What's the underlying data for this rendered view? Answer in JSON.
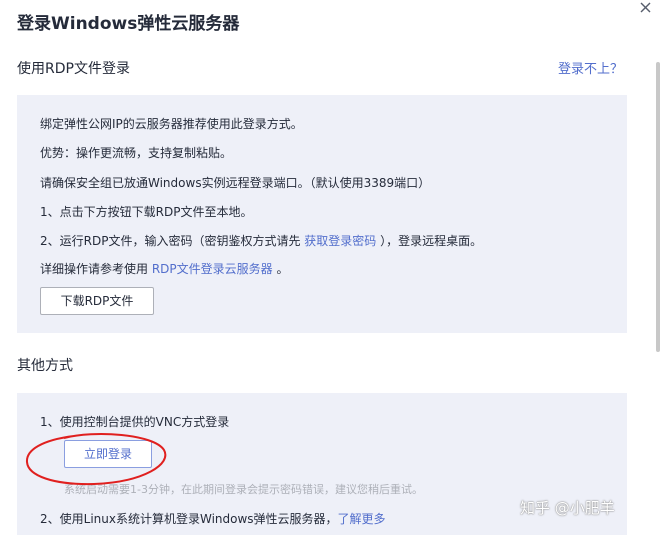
{
  "dialog": {
    "title": "登录Windows弹性云服务器"
  },
  "rdp_section": {
    "title": "使用RDP文件登录",
    "login_fail_link": "登录不上？",
    "line1": "绑定弹性公网IP的云服务器推荐使用此登录方式。",
    "line2": "优势：操作更流畅，支持复制粘贴。",
    "line3": "请确保安全组已放通Windows实例远程登录端口。（默认使用3389端口）",
    "line4": "1、点击下方按钮下载RDP文件至本地。",
    "line5_before": "2、运行RDP文件，输入密码（密钥鉴权方式请先 ",
    "line5_link": "获取登录密码",
    "line5_after": " ），登录远程桌面。",
    "line6_before": "详细操作请参考使用 ",
    "line6_link": "RDP文件登录云服务器",
    "line6_after": " 。",
    "download_button": "下载RDP文件"
  },
  "other_section": {
    "title": "其他方式",
    "vnc_line": "1、使用控制台提供的VNC方式登录",
    "login_now_button": "立即登录",
    "hint": "系统启动需要1-3分钟，在此期间登录会提示密码错误，建议您稍后重试。",
    "linux_line_before": "2、使用Linux系统计算机登录Windows弹性云服务器，",
    "linux_line_link": "了解更多"
  },
  "watermark": "知乎 @小肥羊",
  "icons": {
    "close": "close-icon"
  },
  "colors": {
    "link": "#526ecc",
    "panel_bg": "#eef0f8",
    "annotation": "#e0201f"
  }
}
